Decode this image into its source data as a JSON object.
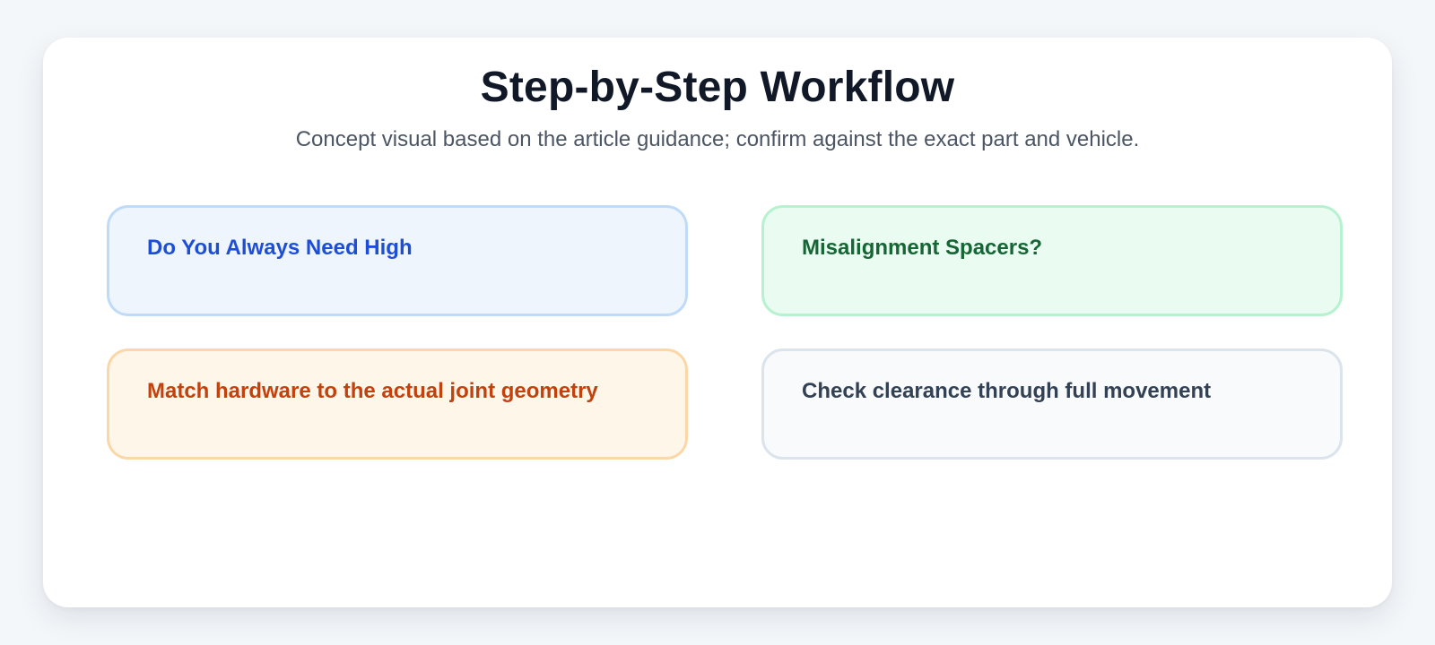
{
  "header": {
    "title": "Step-by-Step Workflow",
    "subtitle": "Concept visual based on the article guidance; confirm against the exact part and vehicle."
  },
  "steps": [
    {
      "label": "Do You Always Need High",
      "bg": "#eef5fd",
      "border": "#bfdbf7",
      "text": "#1d4ed8"
    },
    {
      "label": "Misalignment Spacers?",
      "bg": "#eafbf2",
      "border": "#b7f2d0",
      "text": "#166534"
    },
    {
      "label": "Match hardware to the actual joint geometry",
      "bg": "#fff6ea",
      "border": "#fbd7a8",
      "text": "#c2410c"
    },
    {
      "label": "Check clearance through full movement",
      "bg": "#f8fafc",
      "border": "#dbe3ec",
      "text": "#334155"
    }
  ]
}
